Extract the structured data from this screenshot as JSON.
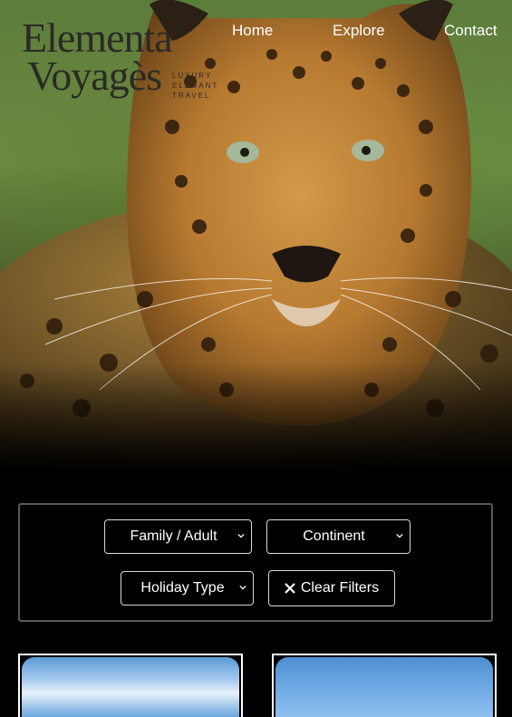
{
  "brand": {
    "line1": "Elementa",
    "line2": "Voyagès",
    "tagline": "LUXURY ELEGANT TRAVEL"
  },
  "nav": {
    "home": "Home",
    "explore": "Explore",
    "contact": "Contact"
  },
  "filters": {
    "family_adult": "Family / Adult",
    "continent": "Continent",
    "holiday_type": "Holiday Type",
    "clear": "Clear Filters"
  },
  "icons": {
    "clear": "close-icon",
    "select": "chevron-down-icon"
  },
  "colors": {
    "background": "#000000",
    "text": "#ffffff",
    "border": "#d8d8d8",
    "logo": "#2b2a25"
  }
}
